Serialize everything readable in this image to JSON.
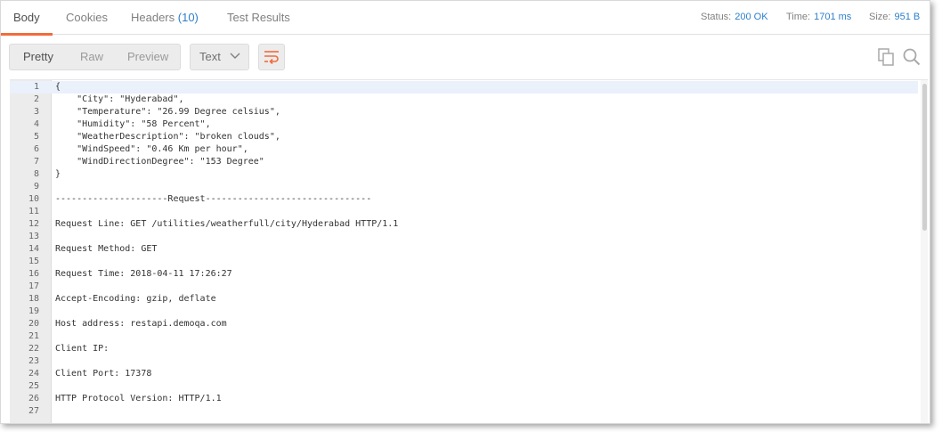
{
  "tabs": {
    "body": "Body",
    "cookies": "Cookies",
    "headers_label": "Headers",
    "headers_count": "(10)",
    "test_results": "Test Results"
  },
  "meta": {
    "status_label": "Status:",
    "status_value": "200 OK",
    "time_label": "Time:",
    "time_value": "1701 ms",
    "size_label": "Size:",
    "size_value": "951 B"
  },
  "toolbar": {
    "pretty": "Pretty",
    "raw": "Raw",
    "preview": "Preview",
    "format_selected": "Text",
    "icons": [
      "chevron-down-icon",
      "wrap-lines-icon",
      "copy-icon",
      "search-icon"
    ]
  },
  "colors": {
    "accent": "#f26b3a",
    "link": "#2d7fcb",
    "active_line": "#eaf1fb"
  },
  "code_lines": [
    "{",
    "    \"City\": \"Hyderabad\",",
    "    \"Temperature\": \"26.99 Degree celsius\",",
    "    \"Humidity\": \"58 Percent\",",
    "    \"WeatherDescription\": \"broken clouds\",",
    "    \"WindSpeed\": \"0.46 Km per hour\",",
    "    \"WindDirectionDegree\": \"153 Degree\"",
    "}",
    "",
    "---------------------Request-------------------------------",
    "",
    "Request Line: GET /utilities/weatherfull/city/Hyderabad HTTP/1.1",
    "",
    "Request Method: GET",
    "",
    "Request Time: 2018-04-11 17:26:27",
    "",
    "Accept-Encoding: gzip, deflate",
    "",
    "Host address: restapi.demoqa.com",
    "",
    "Client IP:",
    "",
    "Client Port: 17378",
    "",
    "HTTP Protocol Version: HTTP/1.1",
    ""
  ],
  "line_numbers": [
    "1",
    "2",
    "3",
    "4",
    "5",
    "6",
    "7",
    "8",
    "9",
    "10",
    "11",
    "12",
    "13",
    "14",
    "15",
    "16",
    "17",
    "18",
    "19",
    "20",
    "21",
    "22",
    "23",
    "24",
    "25",
    "26",
    "27"
  ]
}
